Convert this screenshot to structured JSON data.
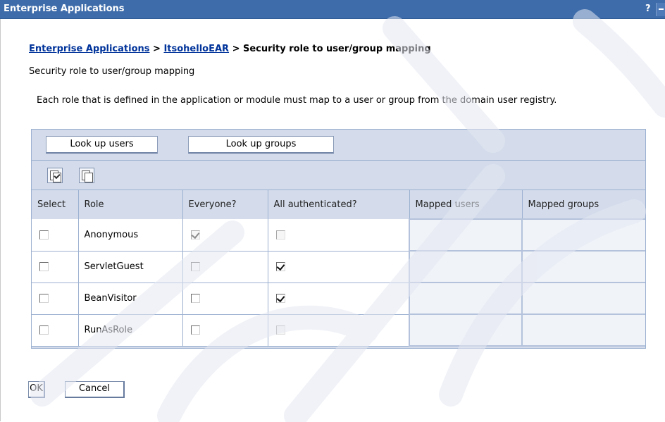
{
  "window": {
    "title": "Enterprise Applications",
    "help_label": "?"
  },
  "breadcrumb": {
    "link1": "Enterprise Applications",
    "sep1": " > ",
    "link2": "ItsohelloEAR",
    "sep2": " > ",
    "current": "Security role to user/group mapping"
  },
  "page": {
    "subtitle": "Security role to user/group mapping",
    "description": "Each role that is defined in the application or module must map to a user or group from the domain user registry."
  },
  "toolbar": {
    "lookup_users": "Look up users",
    "lookup_groups": "Look up groups"
  },
  "icons": {
    "select_all": "select-all-icon",
    "deselect_all": "deselect-all-icon"
  },
  "table": {
    "headers": [
      "Select",
      "Role",
      "Everyone?",
      "All authenticated?",
      "Mapped users",
      "Mapped groups"
    ],
    "rows": [
      {
        "select": false,
        "role": "Anonymous",
        "everyone": true,
        "everyone_disabled": true,
        "authenticated": false,
        "authenticated_disabled": true,
        "mapped_users": "",
        "mapped_groups": ""
      },
      {
        "select": false,
        "role": "ServletGuest",
        "everyone": false,
        "everyone_disabled": false,
        "authenticated": true,
        "authenticated_disabled": false,
        "mapped_users": "",
        "mapped_groups": ""
      },
      {
        "select": false,
        "role": "BeanVisitor",
        "everyone": false,
        "everyone_disabled": false,
        "authenticated": true,
        "authenticated_disabled": false,
        "mapped_users": "",
        "mapped_groups": ""
      },
      {
        "select": false,
        "role": "RunAsRole",
        "everyone": false,
        "everyone_disabled": false,
        "authenticated": false,
        "authenticated_disabled": true,
        "mapped_users": "",
        "mapped_groups": ""
      }
    ]
  },
  "actions": {
    "ok": "OK",
    "cancel": "Cancel"
  },
  "colors": {
    "titlebar": "#3e6caa",
    "link": "#00339a",
    "panel": "#d4dceb",
    "border": "#9bb0d0"
  }
}
